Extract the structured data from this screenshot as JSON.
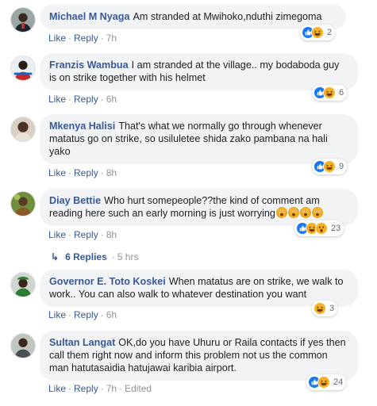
{
  "actions": {
    "like": "Like",
    "reply": "Reply",
    "edited": "Edited"
  },
  "comments": [
    {
      "author": "Michael M Nyaga",
      "text": "Am stranded at Mwihoko,nduthi zimegoma",
      "time": "7h",
      "reaction_count": "2"
    },
    {
      "author": "Franzis Wambua",
      "text": "I am stranded at the village.. my bodaboda guy is on strike together with his helmet",
      "time": "6h",
      "reaction_count": "6"
    },
    {
      "author": "Mkenya Halisi",
      "text": "That's what we normally go through whenever matatus go on strike, so usiluletee shida zako pambana na hali yako",
      "time": "8h",
      "reaction_count": "9"
    },
    {
      "author": "Diay Bettie",
      "text": "Who hurt somepeople??the kind of comment am reading here such an early morning is just worrying",
      "time": "8h",
      "reaction_count": "23"
    },
    {
      "author": "Governor E. Toto Koskei",
      "text": "When matatus are on strike, we walk to work.. You can also walk to whatever destination you want",
      "time": "6h",
      "reaction_count": "3"
    },
    {
      "author": "Sultan Langat",
      "text": "OK,do you have Uhuru or Raila contacts if yes then call them right now and inform this problem not us the common man hatutasaidia hatujawai karibia airport.",
      "time": "7h",
      "reaction_count": "24"
    }
  ],
  "replies_link": {
    "label": "6 Replies",
    "time": "5 hrs"
  },
  "colors": {
    "link": "#385898",
    "bubble": "#f2f3f5",
    "meta": "#606770",
    "like_blue": "#1877f2",
    "haha_yellow": "#f7b125"
  },
  "icons": [
    "like-icon",
    "haha-icon",
    "wow-icon",
    "reply-arrow-icon",
    "scared-emoji-icon"
  ]
}
